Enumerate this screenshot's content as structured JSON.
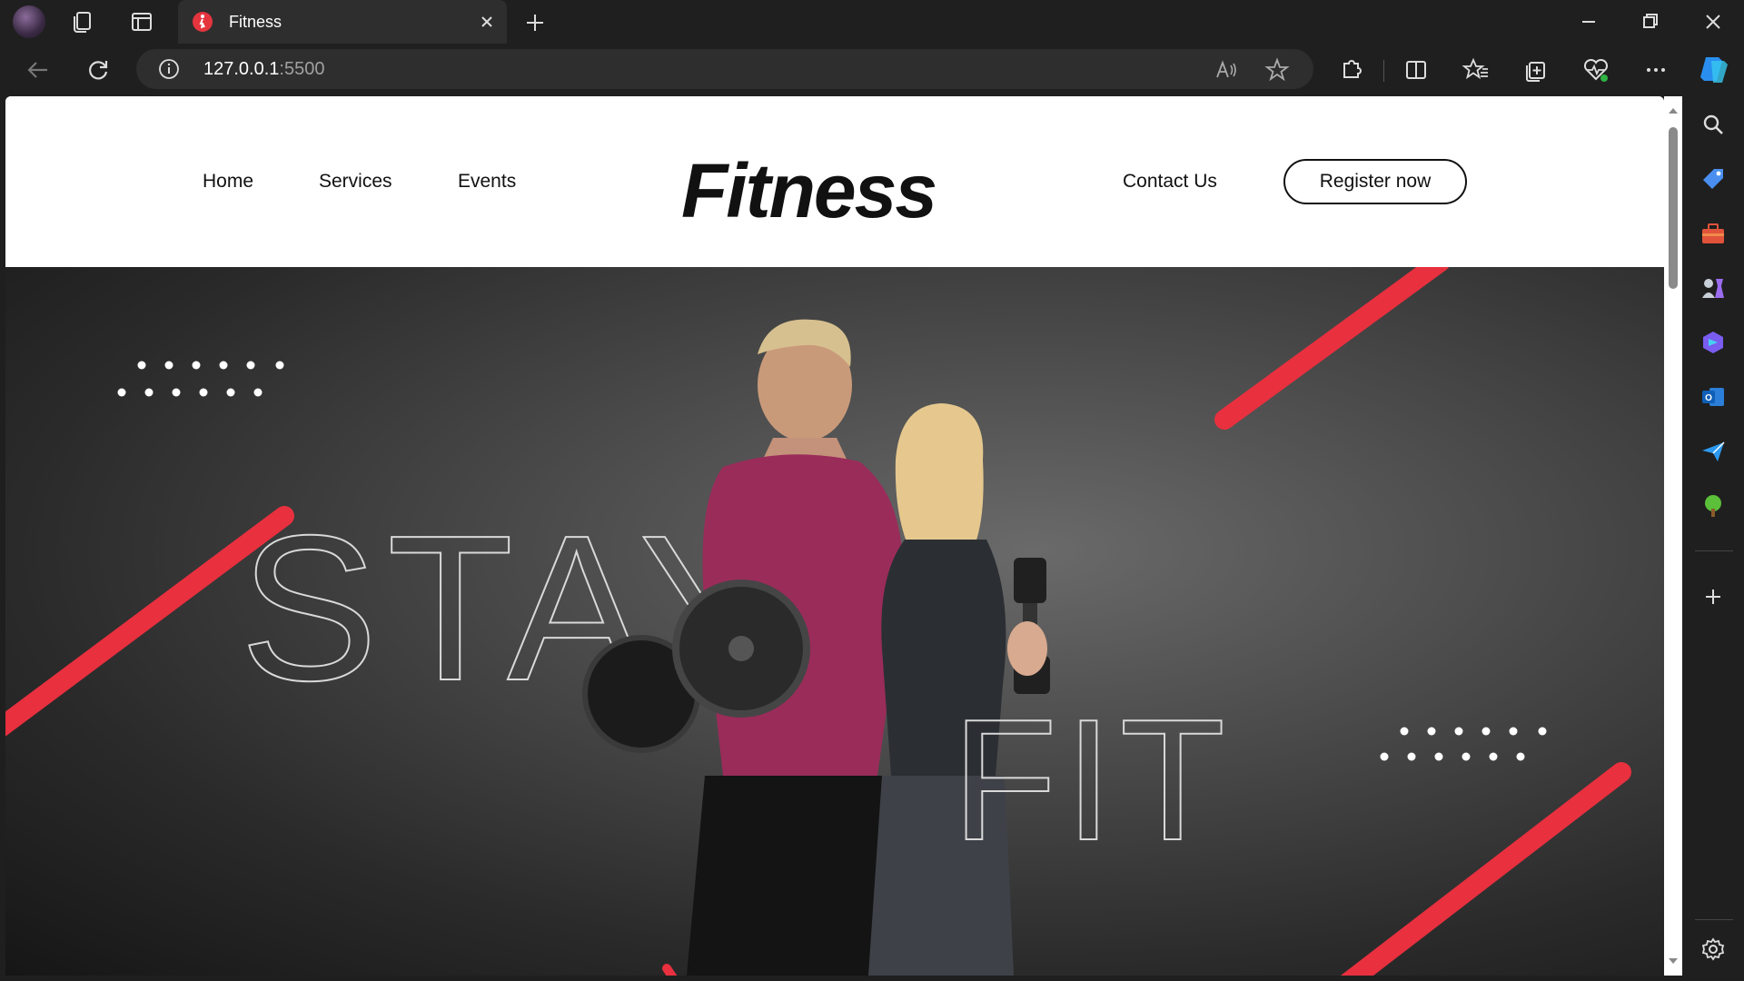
{
  "browser": {
    "tab_title": "Fitness",
    "url_host": "127.0.0.1",
    "url_port": ":5500"
  },
  "site": {
    "nav": [
      "Home",
      "Services",
      "Events"
    ],
    "logo": "Fitness",
    "contact": "Contact Us",
    "register": "Register now",
    "hero_word_1": "STAY",
    "hero_word_2": "FIT"
  },
  "colors": {
    "accent_red": "#e8303f",
    "hero_dark": "#2a2a2a"
  },
  "side_panel_icons": [
    "search-icon",
    "tag-icon",
    "toolbox-icon",
    "games-icon",
    "copilot-icon",
    "outlook-icon",
    "send-icon",
    "tree-icon",
    "add-icon",
    "settings-icon"
  ]
}
